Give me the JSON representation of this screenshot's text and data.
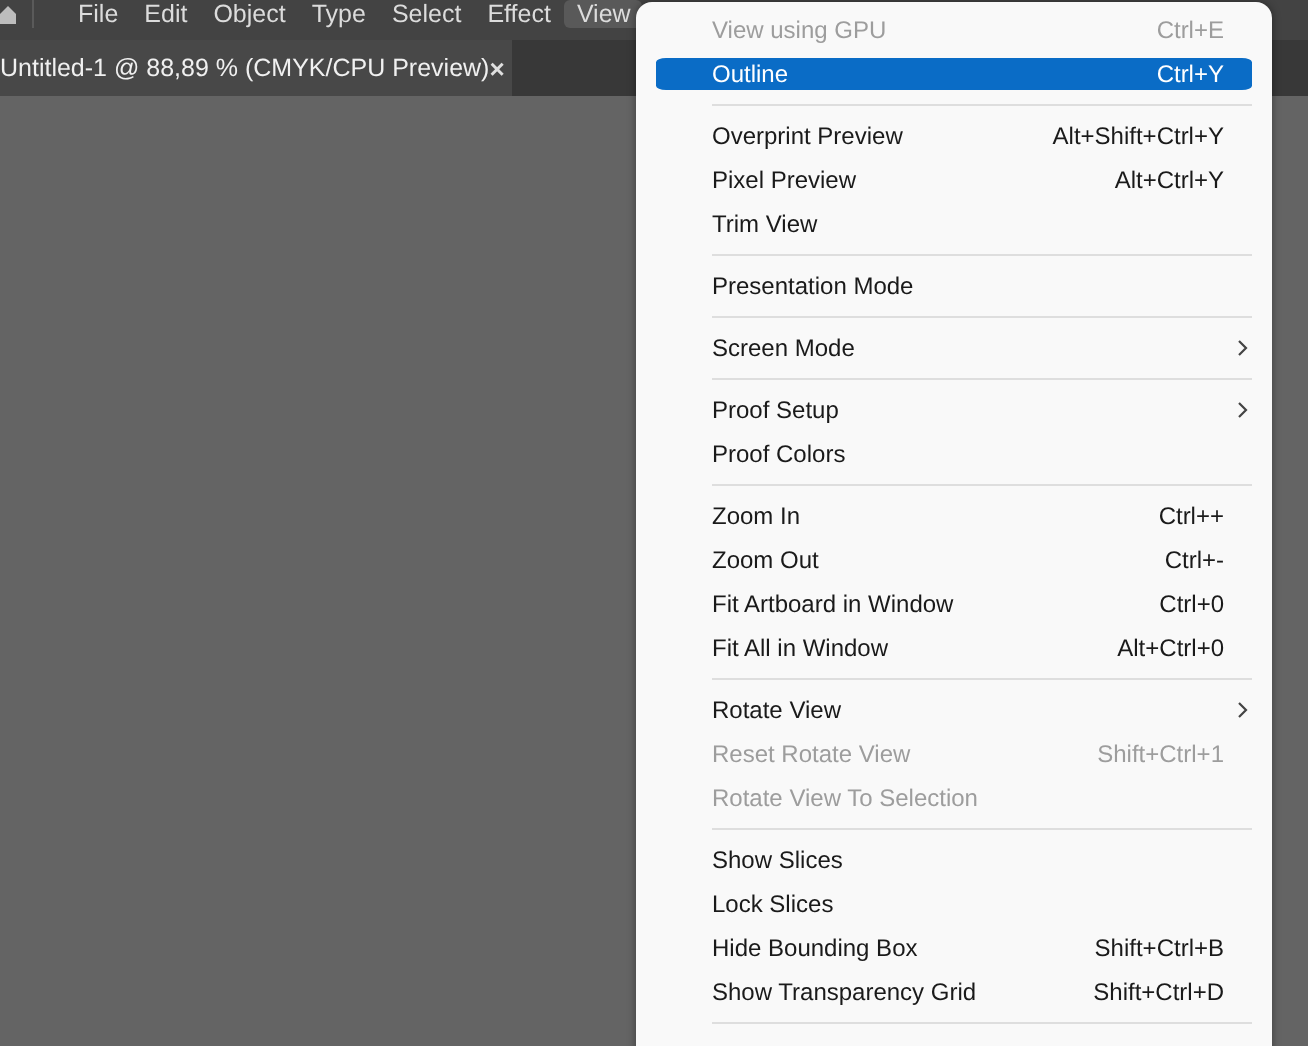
{
  "menubar": {
    "items": [
      {
        "label": "File",
        "selected": false
      },
      {
        "label": "Edit",
        "selected": false
      },
      {
        "label": "Object",
        "selected": false
      },
      {
        "label": "Type",
        "selected": false
      },
      {
        "label": "Select",
        "selected": false
      },
      {
        "label": "Effect",
        "selected": false
      },
      {
        "label": "View",
        "selected": true
      }
    ]
  },
  "document_tab": {
    "title": "Untitled-1 @ 88,89 % (CMYK/CPU Preview)",
    "close": "×"
  },
  "view_menu": {
    "items": [
      {
        "kind": "item",
        "label": "View using GPU",
        "shortcut": "Ctrl+E",
        "disabled": true,
        "selected": false,
        "submenu": false
      },
      {
        "kind": "item",
        "label": "Outline",
        "shortcut": "Ctrl+Y",
        "disabled": false,
        "selected": true,
        "submenu": false
      },
      {
        "kind": "separator"
      },
      {
        "kind": "item",
        "label": "Overprint Preview",
        "shortcut": "Alt+Shift+Ctrl+Y",
        "disabled": false,
        "selected": false,
        "submenu": false
      },
      {
        "kind": "item",
        "label": "Pixel Preview",
        "shortcut": "Alt+Ctrl+Y",
        "disabled": false,
        "selected": false,
        "submenu": false
      },
      {
        "kind": "item",
        "label": "Trim View",
        "disabled": false,
        "selected": false,
        "submenu": false
      },
      {
        "kind": "separator"
      },
      {
        "kind": "item",
        "label": "Presentation Mode",
        "disabled": false,
        "selected": false,
        "submenu": false
      },
      {
        "kind": "separator"
      },
      {
        "kind": "item",
        "label": "Screen Mode",
        "disabled": false,
        "selected": false,
        "submenu": true
      },
      {
        "kind": "separator"
      },
      {
        "kind": "item",
        "label": "Proof Setup",
        "disabled": false,
        "selected": false,
        "submenu": true
      },
      {
        "kind": "item",
        "label": "Proof Colors",
        "disabled": false,
        "selected": false,
        "submenu": false
      },
      {
        "kind": "separator"
      },
      {
        "kind": "item",
        "label": "Zoom In",
        "shortcut": "Ctrl++",
        "disabled": false,
        "selected": false,
        "submenu": false
      },
      {
        "kind": "item",
        "label": "Zoom Out",
        "shortcut": "Ctrl+-",
        "disabled": false,
        "selected": false,
        "submenu": false
      },
      {
        "kind": "item",
        "label": "Fit Artboard in Window",
        "shortcut": "Ctrl+0",
        "disabled": false,
        "selected": false,
        "submenu": false
      },
      {
        "kind": "item",
        "label": "Fit All in Window",
        "shortcut": "Alt+Ctrl+0",
        "disabled": false,
        "selected": false,
        "submenu": false
      },
      {
        "kind": "separator"
      },
      {
        "kind": "item",
        "label": "Rotate View",
        "disabled": false,
        "selected": false,
        "submenu": true
      },
      {
        "kind": "item",
        "label": "Reset Rotate View",
        "shortcut": "Shift+Ctrl+1",
        "disabled": true,
        "selected": false,
        "submenu": false
      },
      {
        "kind": "item",
        "label": "Rotate View To Selection",
        "disabled": true,
        "selected": false,
        "submenu": false
      },
      {
        "kind": "separator"
      },
      {
        "kind": "item",
        "label": "Show Slices",
        "disabled": false,
        "selected": false,
        "submenu": false
      },
      {
        "kind": "item",
        "label": "Lock Slices",
        "disabled": false,
        "selected": false,
        "submenu": false
      },
      {
        "kind": "item",
        "label": "Hide Bounding Box",
        "shortcut": "Shift+Ctrl+B",
        "disabled": false,
        "selected": false,
        "submenu": false
      },
      {
        "kind": "item",
        "label": "Show Transparency Grid",
        "shortcut": "Shift+Ctrl+D",
        "disabled": false,
        "selected": false,
        "submenu": false
      },
      {
        "kind": "separator"
      }
    ]
  }
}
